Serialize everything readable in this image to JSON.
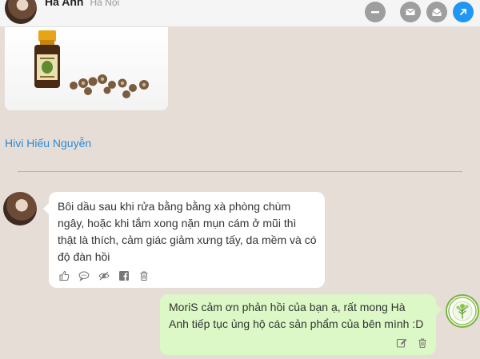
{
  "header": {
    "name": "Hà Anh",
    "location": "Hà Nội"
  },
  "post": {
    "author_link": "Hivi Hiếu Nguyễn"
  },
  "messages": [
    {
      "side": "left",
      "text": "Bôi dầu sau khi rửa bằng bằng xà phòng chùm ngây, hoặc khi tắm xong nặn mụn cám ở mũi thì thật là thích, cảm giác giảm xưng tấy, da mềm và có độ đàn hồi"
    },
    {
      "side": "right",
      "text": "MoriS cảm ơn phản hồi của bạn ạ, rất mong Hà Anh tiếp tục ủng hộ các sản phẩm của bên mình :D"
    }
  ],
  "icons": {
    "header": [
      "minus-icon",
      "mail-icon",
      "mail-open-icon",
      "external-link-icon"
    ],
    "left_actions": [
      "like-icon",
      "comment-icon",
      "hide-icon",
      "facebook-icon",
      "trash-icon"
    ],
    "right_actions": [
      "edit-icon",
      "trash-icon"
    ]
  },
  "colors": {
    "background": "#e6ddd7",
    "link": "#2a8bd6",
    "reply_bubble": "#dcf8c6",
    "accent_blue": "#2196f3"
  }
}
